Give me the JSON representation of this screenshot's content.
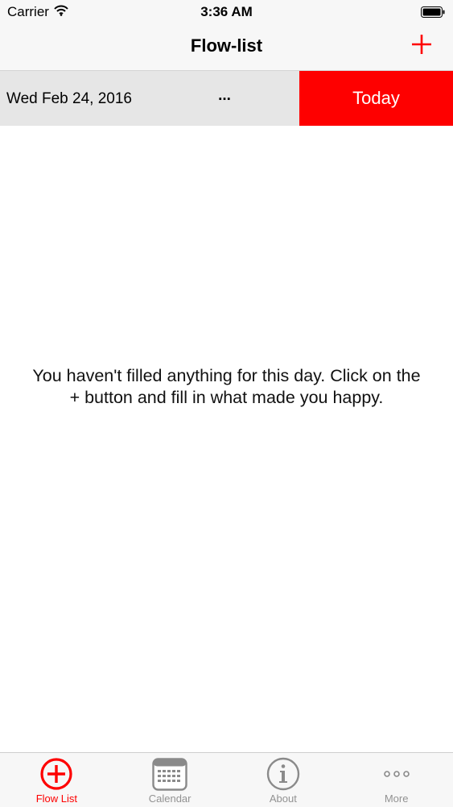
{
  "status_bar": {
    "carrier": "Carrier",
    "time": "3:36 AM",
    "icons": [
      "wifi-icon",
      "battery-icon"
    ]
  },
  "nav_bar": {
    "title": "Flow-list",
    "add_icon": "plus-icon"
  },
  "date_bar": {
    "date": "Wed Feb 24, 2016",
    "more": "...",
    "today": "Today"
  },
  "main": {
    "empty_message": "You haven't filled anything for this day. Click on the + button and fill in what made you happy."
  },
  "tab_bar": {
    "items": [
      {
        "label": "Flow List",
        "icon": "circle-plus-icon",
        "active": true
      },
      {
        "label": "Calendar",
        "icon": "calendar-icon",
        "active": false
      },
      {
        "label": "About",
        "icon": "info-icon",
        "active": false
      },
      {
        "label": "More",
        "icon": "more-dots-icon",
        "active": false
      }
    ]
  },
  "colors": {
    "accent": "#fe0000",
    "bar_background": "#f7f7f7",
    "date_bar_background": "#e6e6e6",
    "inactive_tab": "#929292"
  }
}
